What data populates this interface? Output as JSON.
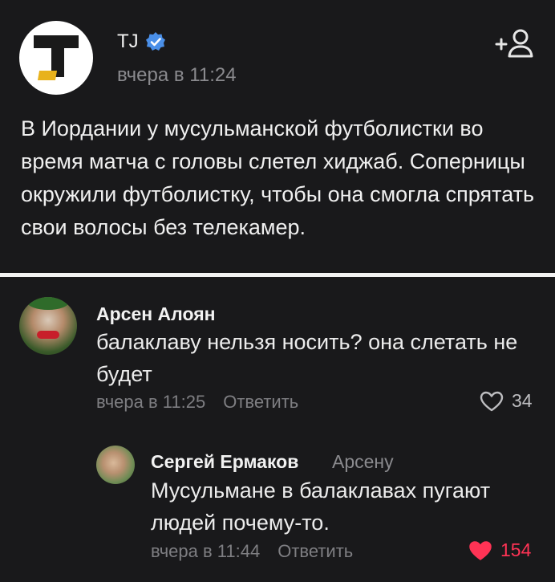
{
  "post": {
    "author": "TJ",
    "time": "вчера в 11:24",
    "text": "В Иордании у мусульманской футболистки во время матча с головы слетел хиджаб. Соперницы окружили футболистку, чтобы она смогла спрятать свои волосы без телекамер."
  },
  "comments": [
    {
      "author": "Арсен Алоян",
      "text": "балаклаву нельзя носить? она слетать не будет",
      "time": "вчера в 11:25",
      "reply_label": "Ответить",
      "likes": "34",
      "liked": false
    },
    {
      "author": "Сергей Ермаков",
      "reply_to": "Арсену",
      "text": "Мусульмане в балаклавах пугают людей почему-то.",
      "time": "вчера в 11:44",
      "reply_label": "Ответить",
      "likes": "154",
      "liked": true
    }
  ],
  "colors": {
    "background": "#19191b",
    "verified": "#4a8fe8",
    "liked": "#ff3355",
    "muted": "#7e7e82"
  },
  "icons": {
    "verified": "verified-badge-icon",
    "follow": "add-person-icon",
    "like": "heart-icon"
  }
}
